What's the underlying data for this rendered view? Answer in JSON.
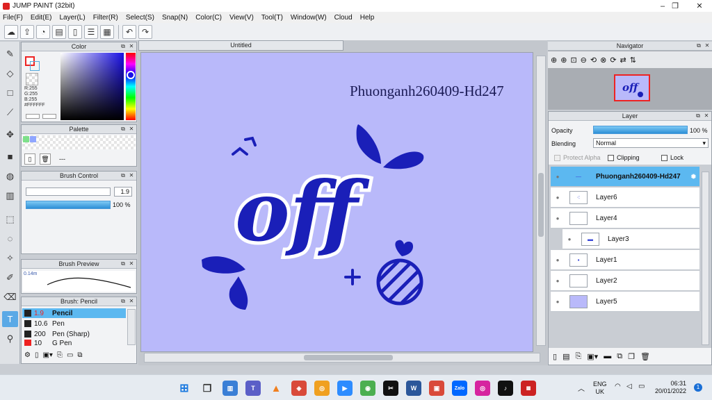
{
  "window": {
    "title": "JUMP PAINT (32bit)",
    "controls": [
      "–",
      "❐",
      "✕"
    ]
  },
  "menu": [
    "File(F)",
    "Edit(E)",
    "Layer(L)",
    "Filter(R)",
    "Select(S)",
    "Snap(N)",
    "Color(C)",
    "View(V)",
    "Tool(T)",
    "Window(W)",
    "Cloud",
    "Help"
  ],
  "toolbar": {
    "icons": [
      "cloud-icon",
      "export-icon",
      "chat-icon",
      "comment-icon",
      "page-icon",
      "list-icon",
      "grid-icon",
      "undo-icon",
      "redo-icon"
    ]
  },
  "color_panel": {
    "title": "Color",
    "r": "R:255",
    "g": "G:255",
    "b": "B:255",
    "hex": "#FFFFFF"
  },
  "palette_panel": {
    "title": "Palette",
    "label": "---",
    "swatches": [
      "#7ee08a",
      "#8fa6ff"
    ]
  },
  "brush_control": {
    "title": "Brush Control",
    "size": "1.9",
    "opacity": "100 %",
    "opacity_fraction": 1.0
  },
  "brush_preview": {
    "title": "Brush Preview",
    "size_label": "0.14m"
  },
  "brush_list": {
    "title": "Brush: Pencil",
    "items": [
      {
        "size": "1.9",
        "name": "Pencil",
        "selected": true
      },
      {
        "size": "10.6",
        "name": "Pen",
        "selected": false
      },
      {
        "size": "200",
        "name": "Pen (Sharp)",
        "selected": false
      },
      {
        "size": "10",
        "name": "G Pen",
        "selected": false
      }
    ]
  },
  "canvas": {
    "tab": "Untitled",
    "watermark": "Phuonganh260409-Hd247",
    "art_text": "off"
  },
  "navigator": {
    "title": "Navigator"
  },
  "layer_panel": {
    "title": "Layer",
    "opacity_label": "Opacity",
    "opacity_value": "100 %",
    "blending_label": "Blending",
    "blending_value": "Normal",
    "protect_alpha": "Protect Alpha",
    "clipping": "Clipping",
    "lock": "Lock",
    "layers": [
      {
        "name": "Phuonganh260409-Hd247",
        "selected": true
      },
      {
        "name": "Layer6",
        "selected": false
      },
      {
        "name": "Layer4",
        "selected": false
      },
      {
        "name": "Layer3",
        "selected": false
      },
      {
        "name": "Layer1",
        "selected": false
      },
      {
        "name": "Layer2",
        "selected": false
      },
      {
        "name": "Layer5",
        "selected": false
      }
    ]
  },
  "taskbar": {
    "lang_top": "ENG",
    "lang_bottom": "UK",
    "time": "06:31",
    "date": "20/01/2022",
    "notification_count": "1"
  },
  "colors": {
    "canvas_bg": "#b9b9fa",
    "art_blue": "#1a1fb8",
    "accent": "#5cb8f0"
  }
}
